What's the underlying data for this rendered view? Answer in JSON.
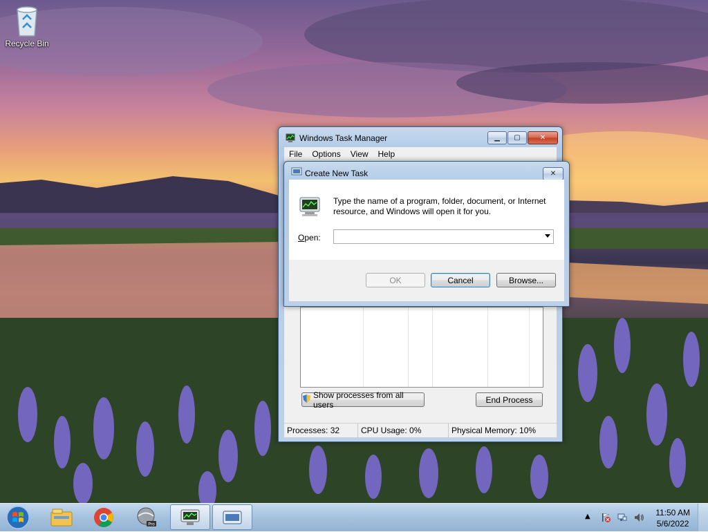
{
  "desktop": {
    "icons": [
      {
        "label": "Recycle Bin",
        "icon": "recycle-bin-icon"
      }
    ]
  },
  "task_manager": {
    "title": "Windows Task Manager",
    "menu": [
      "File",
      "Options",
      "View",
      "Help"
    ],
    "buttons": {
      "show_all_users": "Show processes from all users",
      "end_process": "End Process"
    },
    "status": {
      "processes": "Processes: 32",
      "cpu": "CPU Usage: 0%",
      "memory": "Physical Memory: 10%"
    }
  },
  "create_task_dialog": {
    "title": "Create New Task",
    "description": "Type the name of a program, folder, document, or Internet resource, and Windows will open it for you.",
    "open_label": "Open:",
    "open_value": "",
    "buttons": {
      "ok": "OK",
      "cancel": "Cancel",
      "browse": "Browse..."
    }
  },
  "taskbar": {
    "pinned": [
      "windows-explorer-icon",
      "chrome-icon",
      "google-earth-pro-icon",
      "task-manager-icon",
      "run-dialog-icon"
    ],
    "time": "11:50 AM",
    "date": "5/6/2022"
  },
  "colors": {
    "titlebar": "#bcd0e8",
    "close_button": "#c4401f",
    "dialog_background": "#f0f0f0"
  }
}
